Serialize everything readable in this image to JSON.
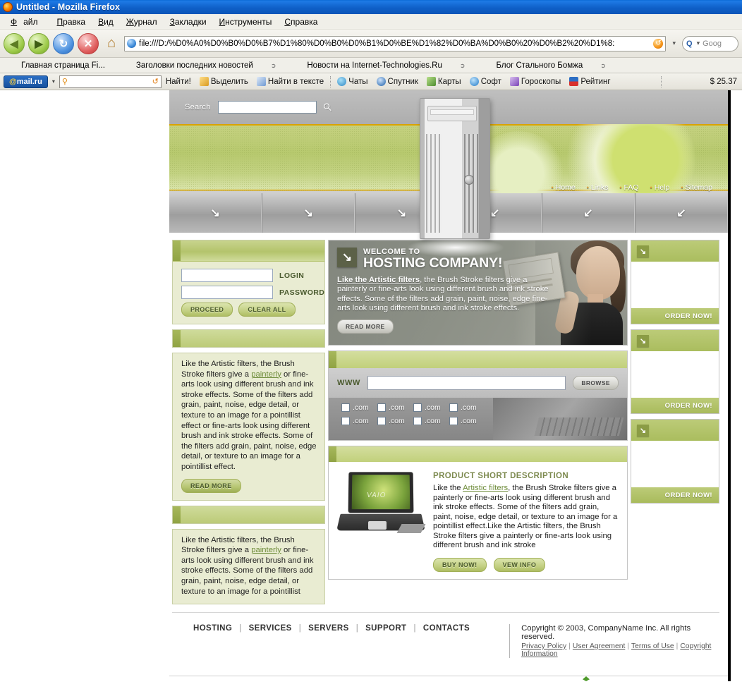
{
  "browser": {
    "window_title": "Untitled - Mozilla Firefox",
    "menu": [
      "Файл",
      "Правка",
      "Вид",
      "Журнал",
      "Закладки",
      "Инструменты",
      "Справка"
    ],
    "nav_buttons": {
      "back": "◀",
      "forward": "▶",
      "reload": "↻",
      "stop": "✕",
      "home": "⌂"
    },
    "url": "file:///D:/%D0%A0%D0%B0%D0%B7%D1%80%D0%B0%D0%B1%D0%BE%D1%82%D0%BA%D0%B0%20%D0%B2%20%D1%8:",
    "search_placeholder": "Goog",
    "search_icon_label": "Q",
    "bookmarks": [
      "Главная страница Fi...",
      "Заголовки последних новостей",
      "Новости на Internet-Technologies.Ru",
      "Блог Стального Бомжа"
    ],
    "mailbar": {
      "logo": "mail.ru",
      "search_value": "",
      "find_button": "Найти!",
      "items": [
        {
          "label": "Выделить",
          "icon": "pencil-icon"
        },
        {
          "label": "Найти в тексте",
          "icon": "find-in-page-icon"
        },
        {
          "label": "Чаты",
          "icon": "chat-icon"
        },
        {
          "label": "Спутник",
          "icon": "satellite-icon"
        },
        {
          "label": "Карты",
          "icon": "maps-icon"
        },
        {
          "label": "Софт",
          "icon": "software-icon"
        },
        {
          "label": "Гороскопы",
          "icon": "horoscope-icon"
        },
        {
          "label": "Рейтинг",
          "icon": "rating-icon"
        }
      ],
      "price": "$ 25.37"
    }
  },
  "site": {
    "search": {
      "label": "Search",
      "value": "",
      "icon": "magnifier-icon"
    },
    "header_nav": [
      "Home",
      "Links",
      "FAQ",
      "Help",
      "Sitemap"
    ],
    "nav_cells": [
      "↘",
      "↘",
      "↘",
      "↙",
      "↙",
      "↙"
    ],
    "login": {
      "login_label": "LOGIN",
      "password_label": "PASSWORD",
      "login_value": "",
      "password_value": "",
      "proceed_button": "PROCEED",
      "clear_button": "CLEAR ALL"
    },
    "sidebar_blocks": [
      {
        "text_before": "Like the Artistic filters, the Brush Stroke filters give a ",
        "link": "painterly",
        "text_after": " or fine-arts look using different brush and ink stroke effects. Some of the filters add grain, paint, noise, edge detail, or texture to an image for a pointillist effect or fine-arts look using different brush and ink stroke effects. Some of the filters add grain, paint, noise, edge detail, or texture to an image for a pointillist effect.",
        "button": "READ MORE"
      },
      {
        "text_before": "Like the Artistic filters, the Brush Stroke filters give a ",
        "link": "painterly",
        "text_after": " or fine-arts look using different brush and ink stroke effects. Some of the filters add grain, paint, noise, edge detail, or texture to an image for a pointillist",
        "button": ""
      }
    ],
    "welcome": {
      "eyebrow": "WELCOME TO",
      "title": "HOSTING COMPANY!",
      "lead": "Like the Artistic filters",
      "body": ", the Brush Stroke filters give a painterly or fine-arts look using different brush and ink stroke effects. Some of the filters add grain, paint, noise, edge fine-arts look using different brush and ink stroke effects.",
      "button": "READ MORE",
      "badge_icon": "arrow-down-right-icon"
    },
    "domain_search": {
      "www_label": "WWW",
      "www_value": "",
      "browse_button": "BROWSE",
      "tlds": [
        ".com",
        ".com",
        ".com",
        ".com",
        ".com",
        ".com",
        ".com",
        ".com"
      ]
    },
    "product": {
      "title": "PRODUCT SHORT DESCRIPTION",
      "text_before": "Like the ",
      "link": "Artistic filters",
      "text_after": ", the Brush Stroke filters give a painterly or fine-arts look using different brush and ink stroke effects. Some of the filters add grain, paint, noise, edge detail, or texture to an image for a pointillist effect.Like the Artistic filters, the Brush Stroke filters give a painterly or fine-arts look using different brush and ink stroke",
      "buy_button": "BUY NOW!",
      "info_button": "VEW INFO",
      "image_label": "VAIO"
    },
    "order_boxes": [
      {
        "label": "ORDER NOW!",
        "icon": "arrow-down-right-icon"
      },
      {
        "label": "ORDER NOW!",
        "icon": "arrow-down-right-icon"
      },
      {
        "label": "ORDER NOW!",
        "icon": "arrow-down-right-icon"
      }
    ],
    "footer": {
      "links": [
        "HOSTING",
        "SERVICES",
        "SERVERS",
        "SUPPORT",
        "CONTACTS"
      ],
      "copyright": "Copyright © 2003, CompanyName Inc. All rights reserved.",
      "legal": [
        "Privacy Policy",
        "User Agreement",
        "Terms of Use",
        "Copyright Information"
      ]
    }
  }
}
